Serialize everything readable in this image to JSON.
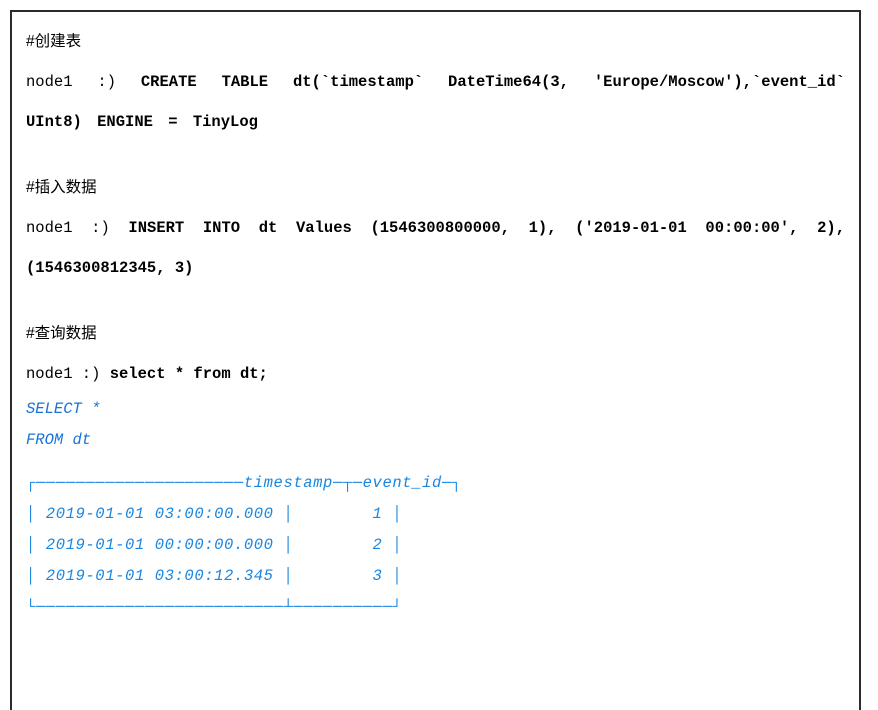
{
  "block": {
    "border_color": "#2b2b2b",
    "background": "#ffffff",
    "prompt_color": "#000000",
    "echo_color": "#1a73d4",
    "grid_color": "#1a86e0"
  },
  "sections": [
    {
      "heading": "#创建表",
      "prompt": "node1   :)   ",
      "sql": "CREATE   TABLE   dt(`timestamp`   DateTime64(3, 'Europe/Moscow'),`event_id` UInt8) ENGINE = TinyLog"
    },
    {
      "heading": "#插入数据",
      "prompt": "node1 :) ",
      "sql": "INSERT INTO dt Values (1546300800000, 1), ('2019-01-01 00:00:00', 2),(1546300812345, 3)"
    },
    {
      "heading": "#查询数据",
      "prompt": "node1 :) ",
      "sql": "select * from dt;"
    }
  ],
  "echo": {
    "line1": "SELECT *",
    "line2": "FROM dt"
  },
  "result_table": {
    "columns": [
      "timestamp",
      "event_id"
    ],
    "rows": [
      {
        "timestamp": "2019-01-01 03:00:00.000",
        "event_id": "1"
      },
      {
        "timestamp": "2019-01-01 00:00:00.000",
        "event_id": "2"
      },
      {
        "timestamp": "2019-01-01 03:00:12.345",
        "event_id": "3"
      }
    ],
    "border_top": "┌─────────────────────timestamp─┬─event_id─┐",
    "row_line_1": "│ 2019-01-01 03:00:00.000 │        1 │",
    "row_line_2": "│ 2019-01-01 00:00:00.000 │        2 │",
    "row_line_3": "│ 2019-01-01 03:00:12.345 │        3 │",
    "border_bottom": "└─────────────────────────┴──────────┘"
  }
}
